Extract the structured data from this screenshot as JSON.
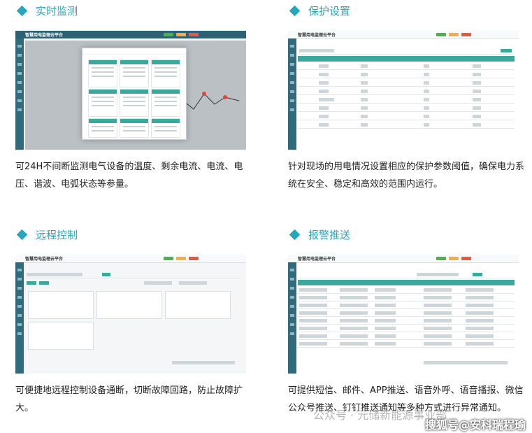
{
  "features": [
    {
      "title": "实时监测",
      "app_name": "智慧用电监理云平台",
      "description": "可24H不间断监测电气设备的温度、剩余电流、电流、电压、谐波、电弧状态等参量。"
    },
    {
      "title": "保护设置",
      "app_name": "智慧用电监理云平台",
      "description": "针对现场的用电情况设置相应的保护参数阈值，确保电力系统在安全、稳定和高效的范围内运行。"
    },
    {
      "title": "远程控制",
      "app_name": "智慧用电监理云平台",
      "description": "可便捷地远程控制设备通断，切断故障回路，防止故障扩大。"
    },
    {
      "title": "报警推送",
      "app_name": "智慧用电监理云平台",
      "description": "可提供短信、邮件、APP推送、语音外呼、语音播报、微信公众号推送、钉钉推送通知等多种方式进行异常通知。"
    }
  ],
  "watermarks": {
    "wechat": "公众号 · 元储新能源事业部",
    "sohu": "搜狐号@安科瑞程瑜"
  },
  "colors": {
    "accent": "#2aa6ba",
    "sidebar": "#2f6a7d",
    "table_header": "#3aa89c"
  }
}
